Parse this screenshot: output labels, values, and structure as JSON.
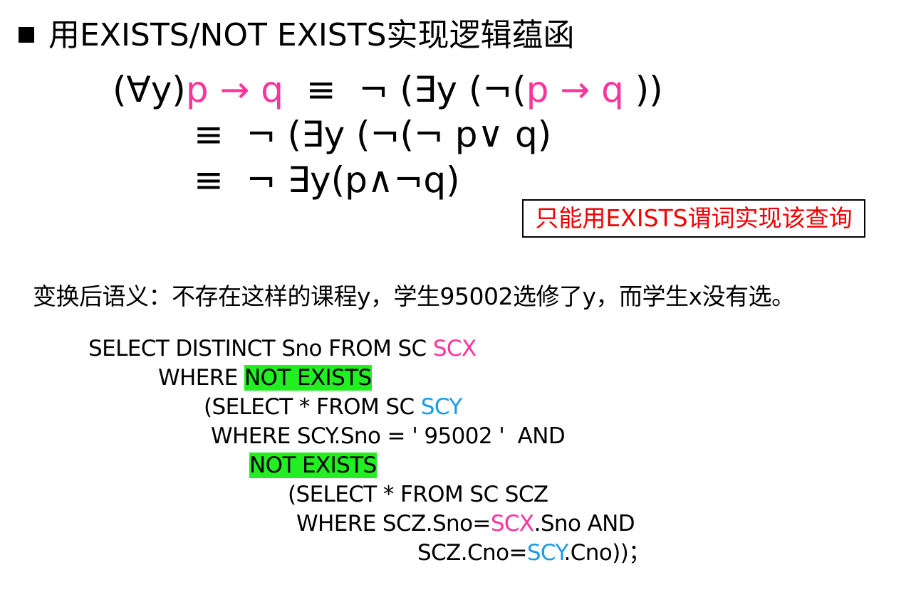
{
  "title": {
    "text": "用EXISTS/NOT EXISTS实现逻辑蕴函"
  },
  "formula": {
    "line1": {
      "lhs_quant": "(∀y)",
      "lhs_impl": "p → q",
      "equiv": "  ≡  ¬ (∃y (¬(",
      "rhs_impl": "p → q",
      "close": " ))"
    },
    "line2": "≡  ¬ (∃y (¬(¬ p∨ q)",
    "line3": "≡  ¬ ∃y(p∧¬q)"
  },
  "note": {
    "text": "只能用EXISTS谓词实现该查询",
    "color": "#ee0000"
  },
  "semantics": {
    "text": "变换后语义：不存在这样的课程y，学生95002选修了y，而学生x没有选。"
  },
  "sql": {
    "line1_prefix": "SELECT DISTINCT Sno FROM SC ",
    "line1_alias": "SCX",
    "line2_prefix": "WHERE ",
    "line2_keyword": "NOT EXISTS",
    "line3_prefix": "(SELECT * FROM SC ",
    "line3_alias": "SCY",
    "line4": "WHERE SCY.Sno = ' 95002 '  AND",
    "line5_keyword": "NOT EXISTS",
    "line6": "(SELECT * FROM SC SCZ",
    "line7_prefix": "WHERE SCZ.Sno=",
    "line7_alias": "SCX",
    "line7_suffix": ".Sno AND",
    "line8_prefix": "SCZ.Cno=",
    "line8_alias": "SCY",
    "line8_suffix": ".Cno))；"
  },
  "colors": {
    "pink": "#ff3399",
    "blue": "#1a9be6",
    "highlight_green": "#22ee22"
  }
}
